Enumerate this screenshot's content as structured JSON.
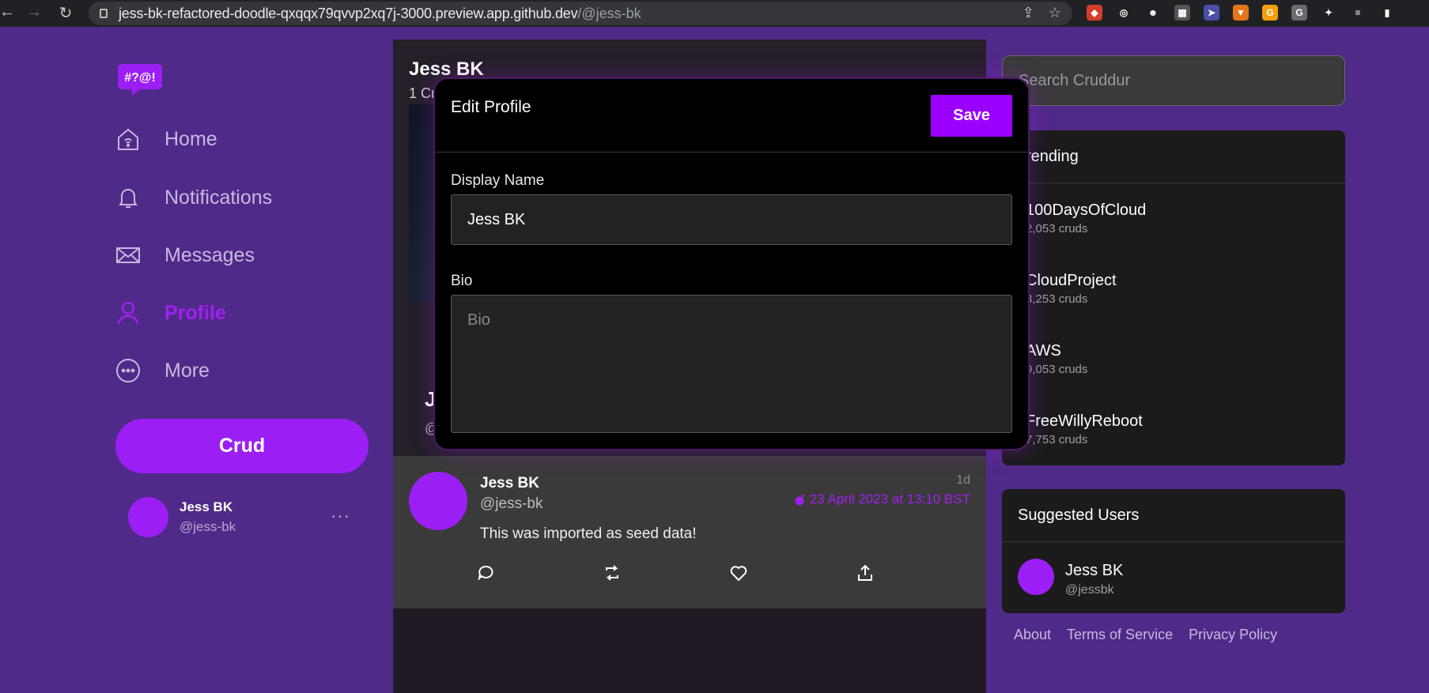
{
  "browser": {
    "url_host": "jess-bk-refactored-doodle-qxqqx79qvvp2xq7j-3000.preview.app.github.dev",
    "url_path": "/@jess-bk",
    "extensions": [
      {
        "name": "red-extension-icon",
        "color": "#d43c2c",
        "glyph": "◆"
      },
      {
        "name": "target-extension-icon",
        "color": "#202124",
        "glyph": "◎"
      },
      {
        "name": "face-extension-icon",
        "color": "#202124",
        "glyph": "☻"
      },
      {
        "name": "grid-extension-icon",
        "color": "#555555",
        "glyph": "▦"
      },
      {
        "name": "cursor-extension-icon",
        "color": "#4a4fa8",
        "glyph": "➤"
      },
      {
        "name": "metamask-extension-icon",
        "color": "#e2761b",
        "glyph": "▼"
      },
      {
        "name": "honey-extension-icon",
        "color": "#f59e0b",
        "glyph": "G"
      },
      {
        "name": "grammarly-extension-icon",
        "color": "#6b6b6b",
        "glyph": "G"
      },
      {
        "name": "puzzle-extension-icon",
        "color": "#202124",
        "glyph": "✦"
      },
      {
        "name": "reading-list-icon",
        "color": "#202124",
        "glyph": "≡"
      },
      {
        "name": "sidepanel-icon",
        "color": "#202124",
        "glyph": "▮"
      }
    ]
  },
  "nav": {
    "items": [
      {
        "label": "Home",
        "icon": "home-icon"
      },
      {
        "label": "Notifications",
        "icon": "bell-icon"
      },
      {
        "label": "Messages",
        "icon": "envelope-icon"
      },
      {
        "label": "Profile",
        "icon": "user-icon",
        "active": true
      },
      {
        "label": "More",
        "icon": "more-circle-icon"
      }
    ],
    "crud_label": "Crud",
    "logo_text": "#?@!",
    "me": {
      "name": "Jess BK",
      "handle": "@jess-bk",
      "more": "···"
    }
  },
  "profile": {
    "name": "Jess BK",
    "count_fragment": "1 Cr",
    "name_fragment": "J",
    "handle_fragment": "@"
  },
  "post": {
    "name": "Jess BK",
    "handle": "@jess-bk",
    "age": "1d",
    "date": "23 April 2023 at 13:10 BST",
    "text": "This was imported as seed data!"
  },
  "modal": {
    "title": "Edit Profile",
    "save_label": "Save",
    "display_name_label": "Display Name",
    "display_name_value": "Jess BK",
    "bio_label": "Bio",
    "bio_placeholder": "Bio"
  },
  "search": {
    "placeholder": "Search Cruddur"
  },
  "trending": {
    "title": "rending",
    "items": [
      {
        "name": "100DaysOfCloud",
        "count": "2,053 cruds"
      },
      {
        "name": "CloudProject",
        "count": "3,253 cruds"
      },
      {
        "name": "AWS",
        "count": "9,053 cruds"
      },
      {
        "name": "FreeWillyReboot",
        "count": "7,753 cruds"
      }
    ]
  },
  "suggested": {
    "title": "Suggested Users",
    "user": {
      "name": "Jess BK",
      "handle": "@jessbk"
    }
  },
  "footer": {
    "about": "About",
    "terms": "Terms of Service",
    "privacy": "Privacy Policy"
  },
  "colors": {
    "brand": "#9b1ff5",
    "background": "#502a88",
    "active": "#a020f0"
  }
}
